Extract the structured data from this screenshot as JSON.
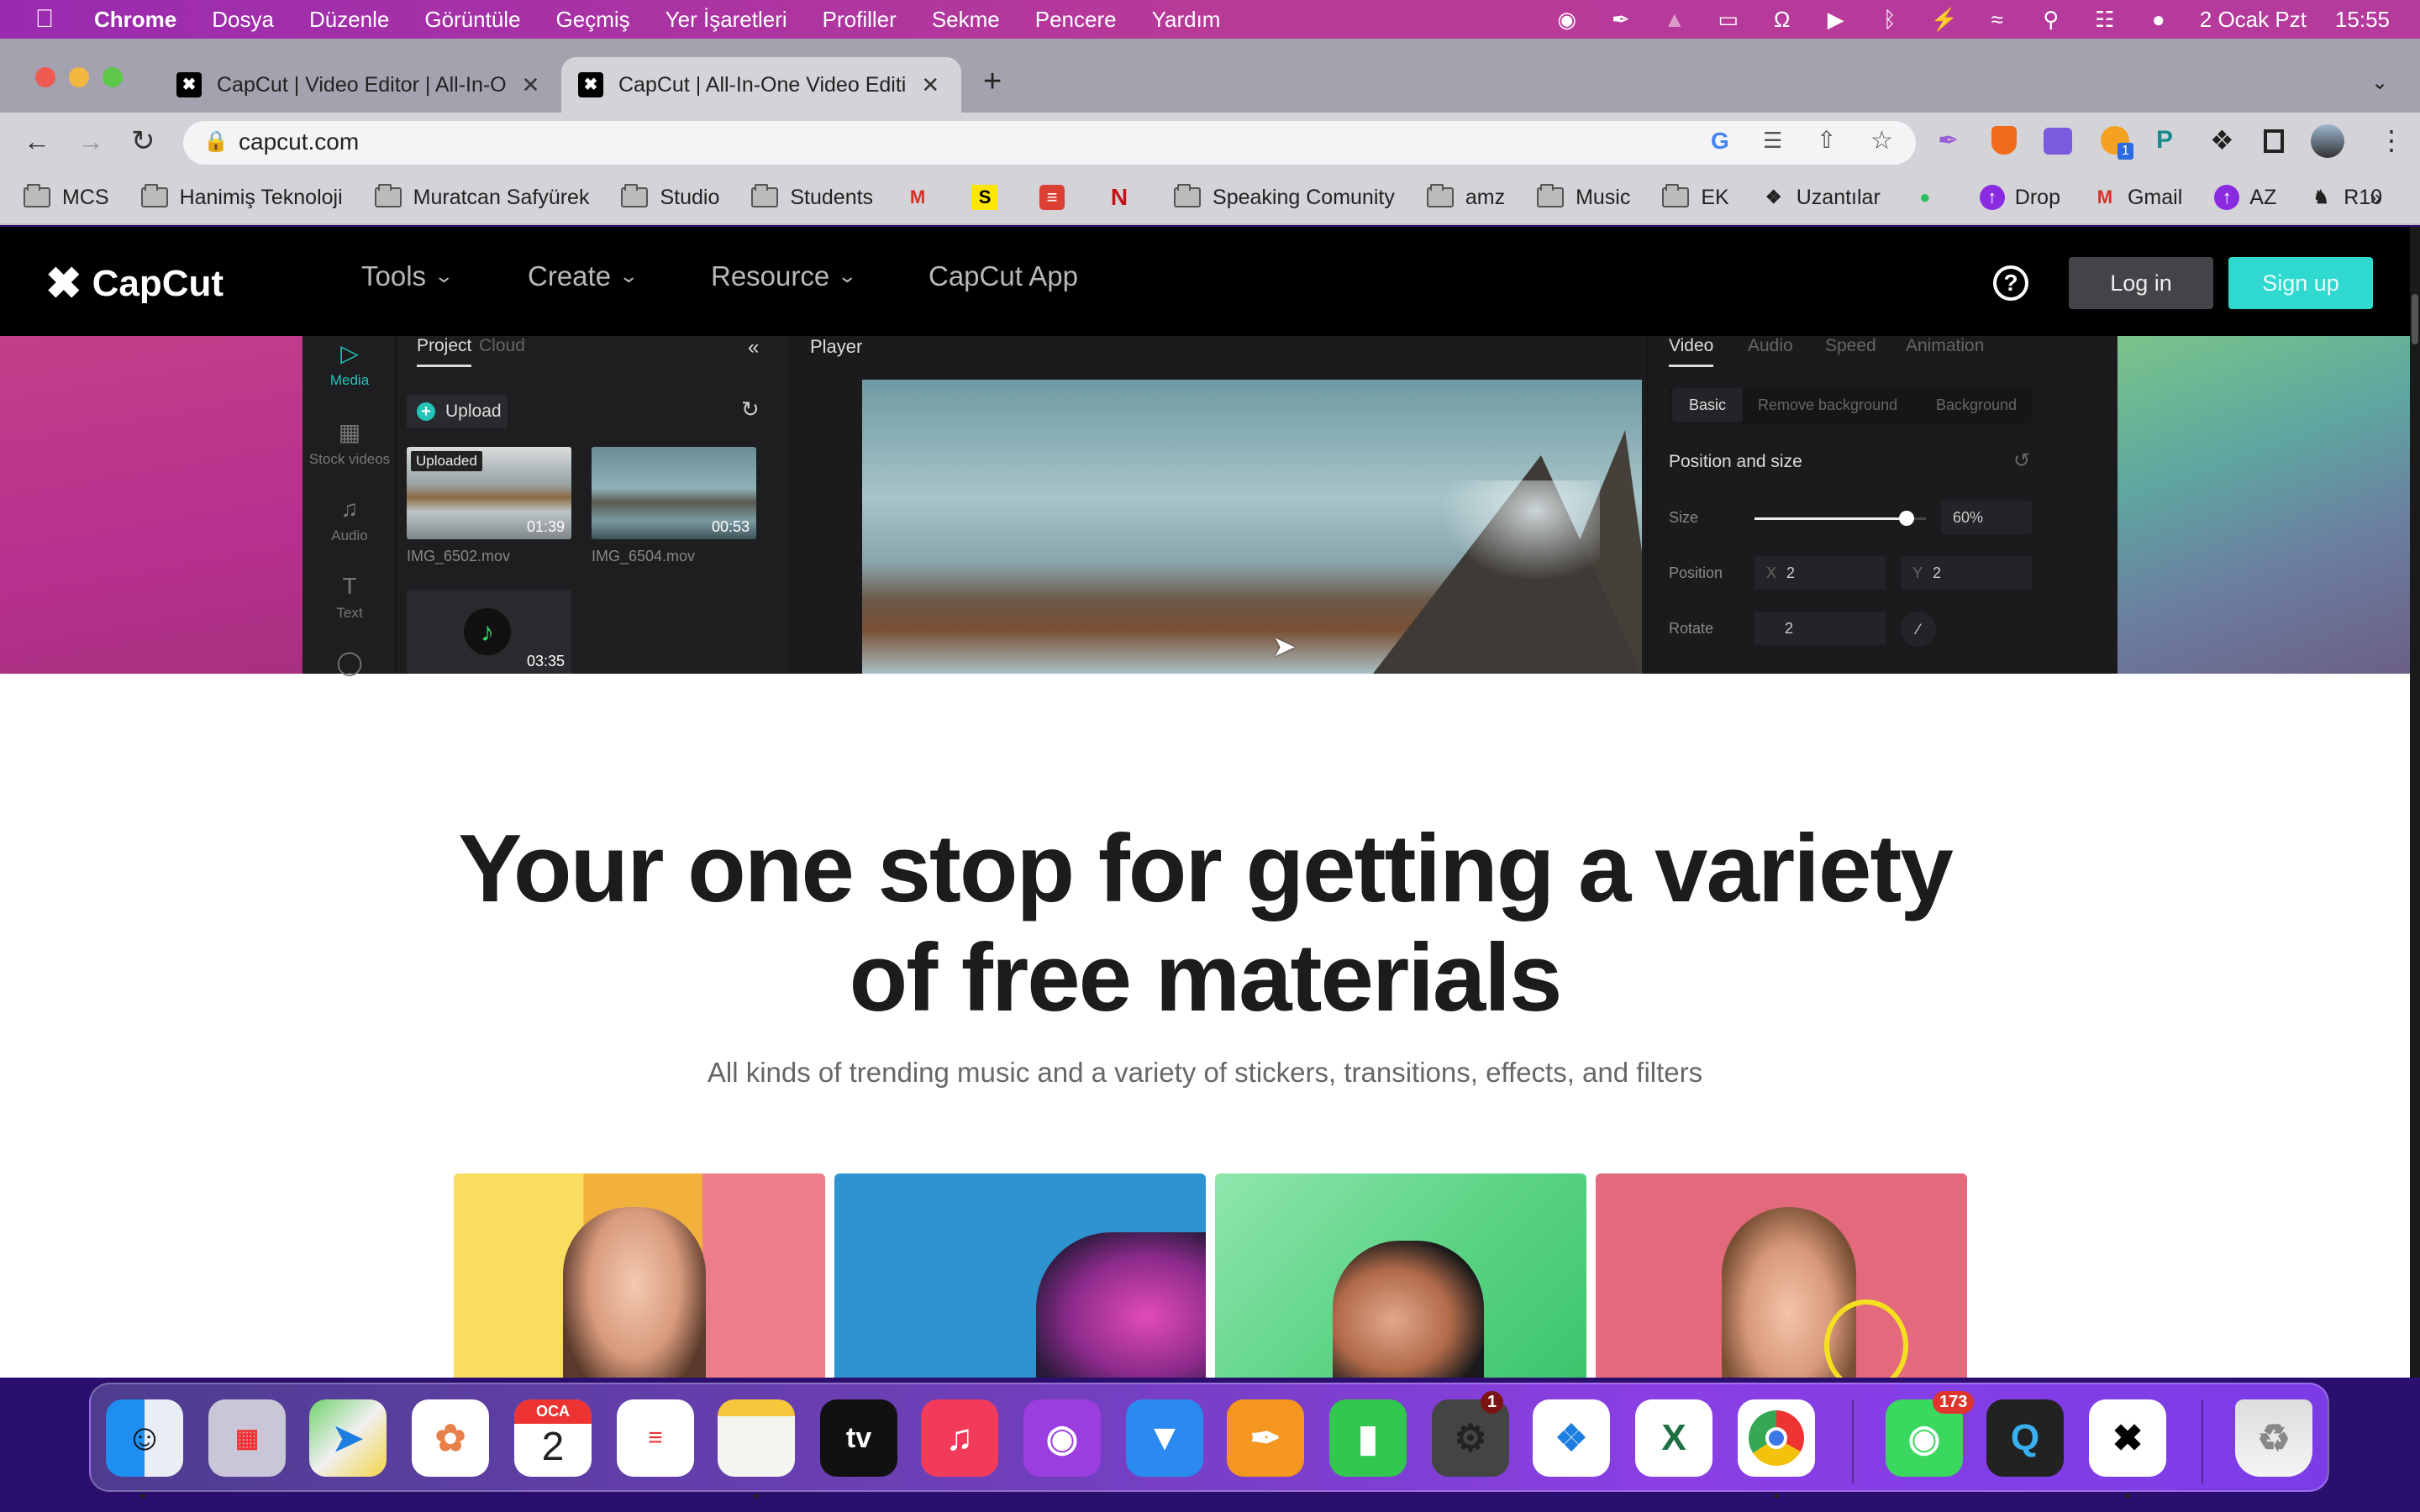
{
  "menubar": {
    "app_name": "Chrome",
    "items": [
      "Dosya",
      "Düzenle",
      "Görüntüle",
      "Geçmiş",
      "Yer İşaretleri",
      "Profiller",
      "Sekme",
      "Pencere",
      "Yardım"
    ],
    "date": "2 Ocak Pzt",
    "time": "15:55",
    "status_icons": [
      "screen-record-icon",
      "feather-icon",
      "app-icon",
      "display-icon",
      "headphones-icon",
      "play-circle-icon",
      "bluetooth-icon",
      "battery-charging-icon",
      "wifi-icon",
      "spotlight-search-icon",
      "control-center-icon",
      "siri-icon"
    ]
  },
  "browser": {
    "tabs": [
      {
        "title": "CapCut | Video Editor | All-In-O",
        "active": false
      },
      {
        "title": "CapCut | All-In-One Video Editi",
        "active": true
      }
    ],
    "new_tab": "+",
    "url": "capcut.com",
    "bookmarks": [
      {
        "label": "MCS",
        "icon": "folder-icon"
      },
      {
        "label": "Hanimiş Teknoloji",
        "icon": "folder-icon"
      },
      {
        "label": "Muratcan Safyürek",
        "icon": "folder-icon"
      },
      {
        "label": "Studio",
        "icon": "folder-icon"
      },
      {
        "label": "Students",
        "icon": "folder-icon"
      },
      {
        "label": "",
        "icon": "gmail-icon"
      },
      {
        "label": "",
        "icon": "s-icon"
      },
      {
        "label": "",
        "icon": "todoist-icon"
      },
      {
        "label": "",
        "icon": "netflix-icon"
      },
      {
        "label": "Speaking Comunity",
        "icon": "folder-icon"
      },
      {
        "label": "amz",
        "icon": "folder-icon"
      },
      {
        "label": "Music",
        "icon": "folder-icon"
      },
      {
        "label": "EK",
        "icon": "folder-icon"
      },
      {
        "label": "Uzantılar",
        "icon": "puzzle-icon"
      },
      {
        "label": "",
        "icon": "evernote-icon"
      },
      {
        "label": "Drop",
        "icon": "upload-circle-icon"
      },
      {
        "label": "Gmail",
        "icon": "gmail-icon"
      },
      {
        "label": "AZ",
        "icon": "upload-circle-icon"
      },
      {
        "label": "R10",
        "icon": "r10-icon"
      }
    ],
    "bookmarks_overflow": "»",
    "extension_badge": "1"
  },
  "capcut": {
    "logo": "CapCut",
    "nav": [
      {
        "label": "Tools",
        "dropdown": true
      },
      {
        "label": "Create",
        "dropdown": true
      },
      {
        "label": "Resource",
        "dropdown": true
      },
      {
        "label": "CapCut App",
        "dropdown": false
      }
    ],
    "login": "Log in",
    "signup": "Sign up",
    "accent": "#2fd9cf",
    "editor": {
      "sidebar": [
        {
          "label": "Media",
          "icon": "media-icon",
          "active": true
        },
        {
          "label": "Stock videos",
          "icon": "film-icon",
          "active": false
        },
        {
          "label": "Audio",
          "icon": "audio-icon",
          "active": false
        },
        {
          "label": "Text",
          "icon": "text-icon",
          "active": false
        },
        {
          "label": "",
          "icon": "sticker-icon",
          "active": false
        }
      ],
      "panel_tabs": [
        "Project",
        "Cloud"
      ],
      "upload": "Upload",
      "media": [
        {
          "name": "IMG_6502.mov",
          "duration": "01:39",
          "badge": "Uploaded"
        },
        {
          "name": "IMG_6504.mov",
          "duration": "00:53",
          "badge": ""
        },
        {
          "name": "",
          "duration": "03:35",
          "badge": ""
        }
      ],
      "player_title": "Player",
      "prop_tabs": [
        "Video",
        "Audio",
        "Speed",
        "Animation"
      ],
      "sub_tabs": [
        "Basic",
        "Remove background",
        "Background"
      ],
      "section_title": "Position and size",
      "size_label": "Size",
      "size_value": "60%",
      "size_fraction": 0.6,
      "position_label": "Position",
      "x_label": "X",
      "x_value": "2",
      "y_label": "Y",
      "y_value": "2",
      "rotate_label": "Rotate",
      "rotate_value": "2"
    },
    "headline_line1": "Your one stop for getting a variety",
    "headline_line2": "of free materials",
    "subheadline": "All kinds of trending music and a variety of stickers, transitions, effects, and filters"
  },
  "dock": {
    "apps": [
      "Finder",
      "Launchpad",
      "Maps",
      "Photos",
      "Calendar",
      "Reminders",
      "Notes",
      "Apple TV",
      "Music",
      "Podcasts",
      "Keynote",
      "Pages",
      "Numbers",
      "System Preferences",
      "Safari",
      "Excel",
      "Chrome",
      "Messages",
      "QuickTime",
      "CapCut",
      "Trash"
    ],
    "calendar_month": "OCA",
    "calendar_day": "2",
    "settings_badge": "1",
    "messages_badge": "173"
  }
}
